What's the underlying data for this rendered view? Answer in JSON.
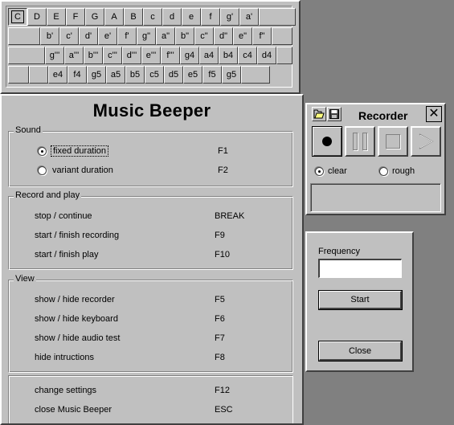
{
  "keyboard": {
    "row1": [
      "C",
      "D",
      "E",
      "F",
      "G",
      "A",
      "B",
      "c",
      "d",
      "e",
      "f",
      "g'",
      "a'"
    ],
    "row2": [
      "b'",
      "c'",
      "d'",
      "e'",
      "f'",
      "g\"",
      "a\"",
      "b\"",
      "c\"",
      "d\"",
      "e\"",
      "f\""
    ],
    "row3": [
      "g'''",
      "a'''",
      "b'''",
      "c'''",
      "d'''",
      "e'''",
      "f'''",
      "g4",
      "a4",
      "b4",
      "c4",
      "d4"
    ],
    "row4": [
      "e4",
      "f4",
      "g5",
      "a5",
      "b5",
      "c5",
      "d5",
      "e5",
      "f5",
      "g5"
    ],
    "pressed_key": "C"
  },
  "main": {
    "title": "Music Beeper",
    "sound": {
      "label": "Sound",
      "items": [
        {
          "label": "fixed duration",
          "shortcut": "F1",
          "selected": true
        },
        {
          "label": "variant duration",
          "shortcut": "F2",
          "selected": false
        }
      ]
    },
    "record": {
      "label": "Record and play",
      "items": [
        {
          "label": "stop / continue",
          "shortcut": "BREAK"
        },
        {
          "label": "start / finish recording",
          "shortcut": "F9"
        },
        {
          "label": "start / finish play",
          "shortcut": "F10"
        }
      ]
    },
    "view": {
      "label": "View",
      "items": [
        {
          "label": "show / hide recorder",
          "shortcut": "F5"
        },
        {
          "label": "show / hide keyboard",
          "shortcut": "F6"
        },
        {
          "label": "show / hide audio test",
          "shortcut": "F7"
        },
        {
          "label": "hide intructions",
          "shortcut": "F8"
        }
      ]
    },
    "other": [
      {
        "label": "change settings",
        "shortcut": "F12"
      },
      {
        "label": "close Music Beeper",
        "shortcut": "ESC"
      }
    ]
  },
  "recorder": {
    "title": "Recorder",
    "close_glyph": "✕",
    "icons": [
      "folder-open-icon",
      "save-icon",
      "record-icon",
      "pause-icon",
      "stop-icon",
      "play-icon"
    ],
    "mode_clear": "clear",
    "mode_rough": "rough",
    "selected_mode": "clear"
  },
  "audio_test": {
    "frequency_label": "Frequency",
    "frequency_value": "",
    "start_label": "Start",
    "close_label": "Close"
  },
  "colors": {
    "desktop": "#808080",
    "face": "#c0c0c0"
  }
}
